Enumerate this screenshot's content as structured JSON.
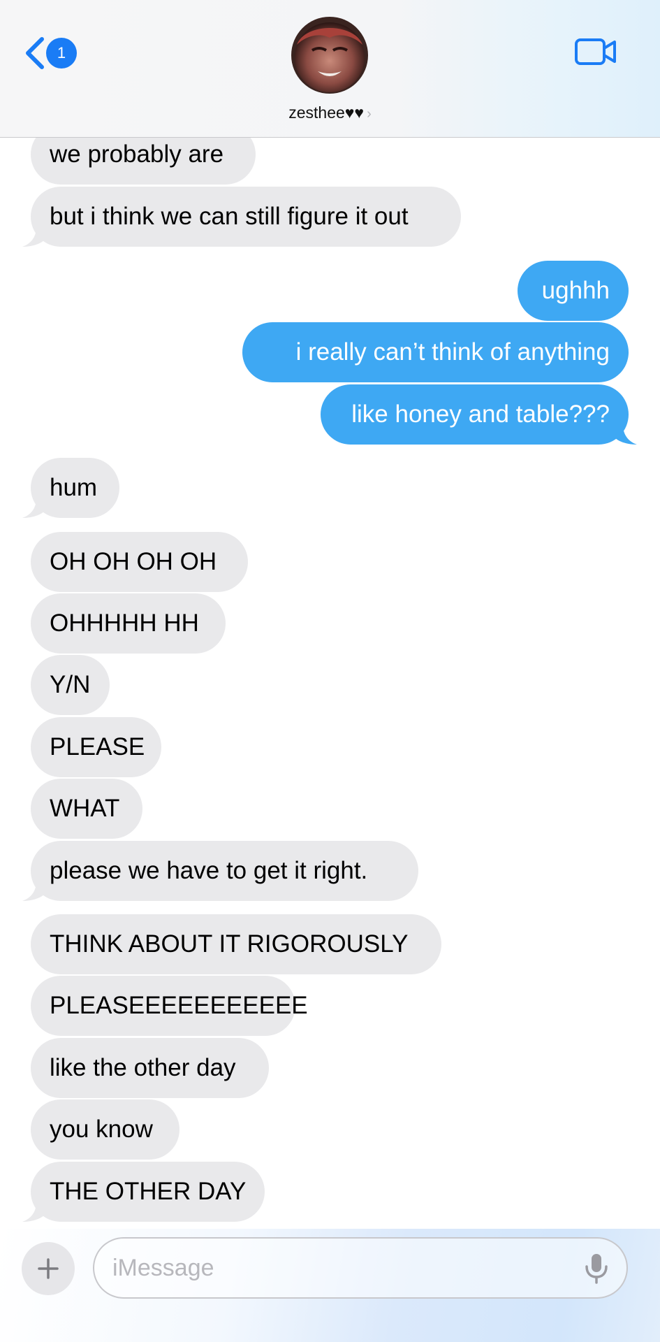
{
  "header": {
    "back_badge_count": "1",
    "contact_name": "zesthee♥♥",
    "chevron": "›",
    "icons": {
      "back": "chevron-left-icon",
      "video": "video-camera-icon"
    },
    "accent_color": "#1a7cf5"
  },
  "messages": [
    {
      "text": "we probably are",
      "side": "received"
    },
    {
      "text": "but i think we can still figure it out",
      "side": "received"
    },
    {
      "text": "ughhh",
      "side": "sent"
    },
    {
      "text": "i really can’t think of anything",
      "side": "sent"
    },
    {
      "text": "like honey and table???",
      "side": "sent"
    },
    {
      "text": "hum",
      "side": "received"
    },
    {
      "text": "OH OH OH OH",
      "side": "received"
    },
    {
      "text": "OHHHHH HH",
      "side": "received"
    },
    {
      "text": "Y/N",
      "side": "received"
    },
    {
      "text": "PLEASE",
      "side": "received"
    },
    {
      "text": "WHAT",
      "side": "received"
    },
    {
      "text": "please we have to get it right.",
      "side": "received"
    },
    {
      "text": "THINK ABOUT IT RIGOROUSLY",
      "side": "received"
    },
    {
      "text": "PLEASEEEEEEEEEEE",
      "side": "received"
    },
    {
      "text": "like the other day",
      "side": "received"
    },
    {
      "text": "you know",
      "side": "received"
    },
    {
      "text": "THE OTHER DAY",
      "side": "received"
    }
  ],
  "composer": {
    "placeholder": "iMessage",
    "value": "",
    "icons": {
      "plus": "plus-icon",
      "mic": "microphone-icon"
    }
  },
  "colors": {
    "sent_bubble": "#3ea8f3",
    "received_bubble": "#e9e9eb"
  }
}
